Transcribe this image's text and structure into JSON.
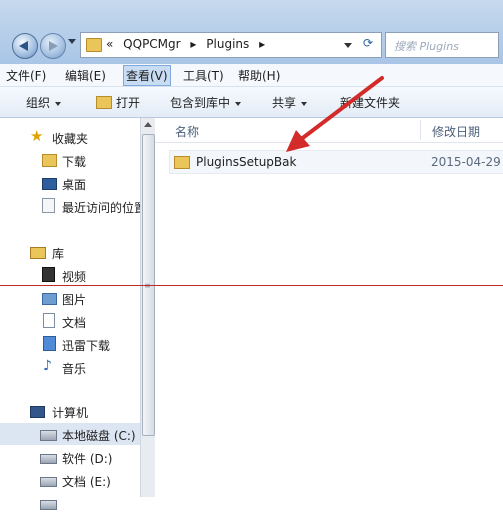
{
  "address": {
    "crumbs": [
      "«",
      "QQPCMgr",
      "Plugins"
    ]
  },
  "search": {
    "placeholder": "搜索 Plugins"
  },
  "menu": [
    "文件(F)",
    "编辑(E)",
    "查看(V)",
    "工具(T)",
    "帮助(H)"
  ],
  "toolbar": {
    "organize": "组织",
    "open": "打开",
    "include": "包含到库中",
    "share": "共享",
    "new_folder": "新建文件夹"
  },
  "sidebar": {
    "favorites": "收藏夹",
    "downloads": "下载",
    "desktop": "桌面",
    "recent": "最近访问的位置",
    "library": "库",
    "video": "视频",
    "pictures": "图片",
    "documents": "文档",
    "thunder": "迅雷下载",
    "music": "音乐",
    "computer": "计算机",
    "drive_c": "本地磁盘 (C:)",
    "drive_d": "软件 (D:)",
    "drive_e": "文档 (E:)"
  },
  "columns": {
    "name": "名称",
    "modified": "修改日期"
  },
  "files": [
    {
      "name": "PluginsSetupBak",
      "date": "2015-04-29"
    }
  ],
  "colors": {
    "annotation": "#d32a2a"
  }
}
